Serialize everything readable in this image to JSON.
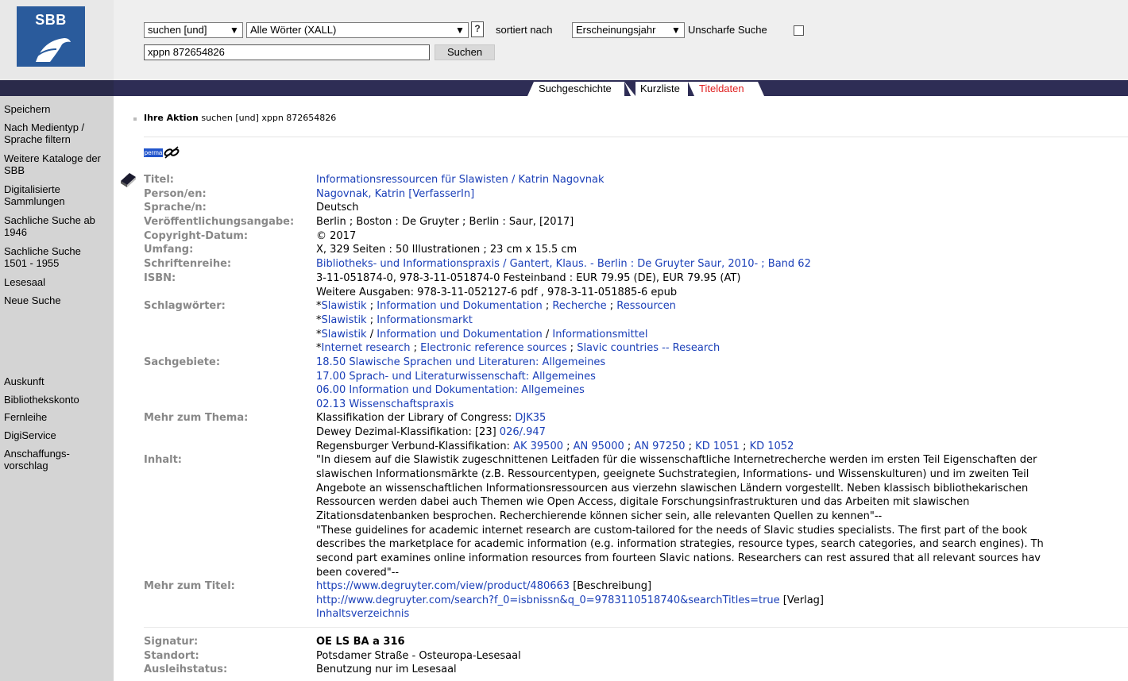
{
  "logo": {
    "text": "SBB"
  },
  "search": {
    "mode": "suchen [und]",
    "scope": "Alle Wörter (XALL)",
    "help": "?",
    "sorted_label": "sortiert nach",
    "sort": "Erscheinungsjahr",
    "fuzzy_label": "Unscharfe Suche",
    "query": "xppn 872654826",
    "submit": "Suchen"
  },
  "tabs": [
    "Suchgeschichte",
    "Kurzliste",
    "Titeldaten"
  ],
  "sidebar": {
    "top": [
      "Speichern",
      "Nach Medientyp / Sprache filtern",
      "Weitere Kataloge der SBB",
      "Digitalisierte Sammlungen",
      "Sachliche Suche ab 1946",
      "Sachliche Suche 1501 - 1955",
      "Lesesaal",
      "Neue Suche"
    ],
    "bottom": [
      "Auskunft",
      "Bibliothekskonto",
      "Fernleihe",
      "DigiService",
      "Anschaffungs-vorschlag"
    ]
  },
  "action": {
    "label": "Ihre Aktion",
    "text": "suchen [und] xppn 872654826"
  },
  "perma": "perma",
  "record": {
    "titel": {
      "label": "Titel:",
      "value": "Informationsressourcen für Slawisten / Katrin Nagovnak"
    },
    "person": {
      "label": "Person/en:",
      "value": "Nagovnak, Katrin [VerfasserIn]"
    },
    "sprache": {
      "label": "Sprache/n:",
      "value": "Deutsch"
    },
    "veroeff": {
      "label": "Veröffentlichungsangabe:",
      "value": "Berlin ; Boston : De Gruyter ; Berlin : Saur, [2017]"
    },
    "copyright": {
      "label": "Copyright-Datum:",
      "value": "© 2017"
    },
    "umfang": {
      "label": "Umfang:",
      "value": "X, 329 Seiten : 50 Illustrationen ; 23 cm x 15.5 cm"
    },
    "reihe": {
      "label": "Schriftenreihe:",
      "value": "Bibliotheks- und Informationspraxis / Gantert, Klaus. - Berlin : De Gruyter Saur, 2010- ; Band 62"
    },
    "isbn": {
      "label": "ISBN:",
      "values": [
        "3-11-051874-0, 978-3-11-051874-0 Festeinband : EUR 79.95 (DE), EUR 79.95 (AT)",
        "Weitere Ausgaben: 978-3-11-052127-6 pdf , 978-3-11-051885-6 epub"
      ]
    },
    "schlag": {
      "label": "Schlagwörter:",
      "rows": [
        [
          "*",
          "Slawistik",
          " ; ",
          "Information und Dokumentation",
          " ; ",
          "Recherche",
          " ; ",
          "Ressourcen"
        ],
        [
          "*",
          "Slawistik",
          " ; ",
          "Informationsmarkt"
        ],
        [
          "*",
          "Slawistik",
          " / ",
          "Information und Dokumentation",
          " / ",
          "Informationsmittel"
        ],
        [
          "*",
          "Internet research",
          " ; ",
          "Electronic reference sources",
          " ; ",
          "Slavic countries -- Research"
        ]
      ]
    },
    "sach": {
      "label": "Sachgebiete:",
      "values": [
        "18.50 Slawische Sprachen und Literaturen: Allgemeines",
        "17.00 Sprach- und Literaturwissenschaft: Allgemeines",
        "06.00 Information und Dokumentation: Allgemeines",
        "02.13 Wissenschaftspraxis"
      ]
    },
    "thema": {
      "label": "Mehr zum Thema:",
      "lc_prefix": "Klassifikation der Library of Congress: ",
      "lc": "DJK35",
      "ddc_prefix": "Dewey Dezimal-Klassifikation: [23] ",
      "ddc": "026/.947",
      "rvk_prefix": "Regensburger Verbund-Klassifikation: ",
      "rvk": [
        "AK 39500",
        "AN 95000",
        "AN 97250",
        "KD 1051",
        "KD 1052"
      ]
    },
    "inhalt": {
      "label": "Inhalt:",
      "lines": [
        "\"In diesem auf die Slawistik zugeschnittenen Leitfaden für die wissenschaftliche Internetrecherche werden im ersten Teil Eigenschaften der",
        "slawischen Informationsmärkte (z.B. Ressourcentypen, geeignete Suchstrategien, Informations- und Wissenskulturen) und im zweiten Teil",
        "Angebote an wissenschaftlichen Informationsressourcen aus vierzehn slawischen Ländern vorgestellt. Neben klassisch bibliothekarischen",
        "Ressourcen werden dabei auch Themen wie Open Access, digitale Forschungsinfrastrukturen und das Arbeiten mit slawischen",
        "Zitationsdatenbanken besprochen. Recherchierende können sicher sein, alle relevanten Quellen zu kennen\"--",
        "\"These guidelines for academic internet research are custom-tailored for the needs of Slavic studies specialists. The first part of the book",
        "describes the marketplace for academic information (e.g. information strategies, resource types, search categories, and search engines). Th",
        "second part examines online information resources from fourteen Slavic nations. Researchers can rest assured that all relevant sources hav",
        "been covered\"--"
      ]
    },
    "mehr_titel": {
      "label": "Mehr zum Titel:",
      "links": [
        {
          "url": "https://www.degruyter.com/view/product/480663",
          "suffix": " [Beschreibung]"
        },
        {
          "url": "http://www.degruyter.com/search?f_0=isbnissn&q_0=9783110518740&searchTitles=true",
          "suffix": " [Verlag]"
        },
        {
          "url": "Inhaltsverzeichnis",
          "suffix": ""
        }
      ]
    },
    "signatur": {
      "label": "Signatur:",
      "value": "OE LS BA a 316"
    },
    "standort": {
      "label": "Standort:",
      "value": "Potsdamer Straße - Osteuropa-Lesesaal"
    },
    "ausleih": {
      "label": "Ausleihstatus:",
      "value": "Benutzung nur im Lesesaal"
    }
  }
}
